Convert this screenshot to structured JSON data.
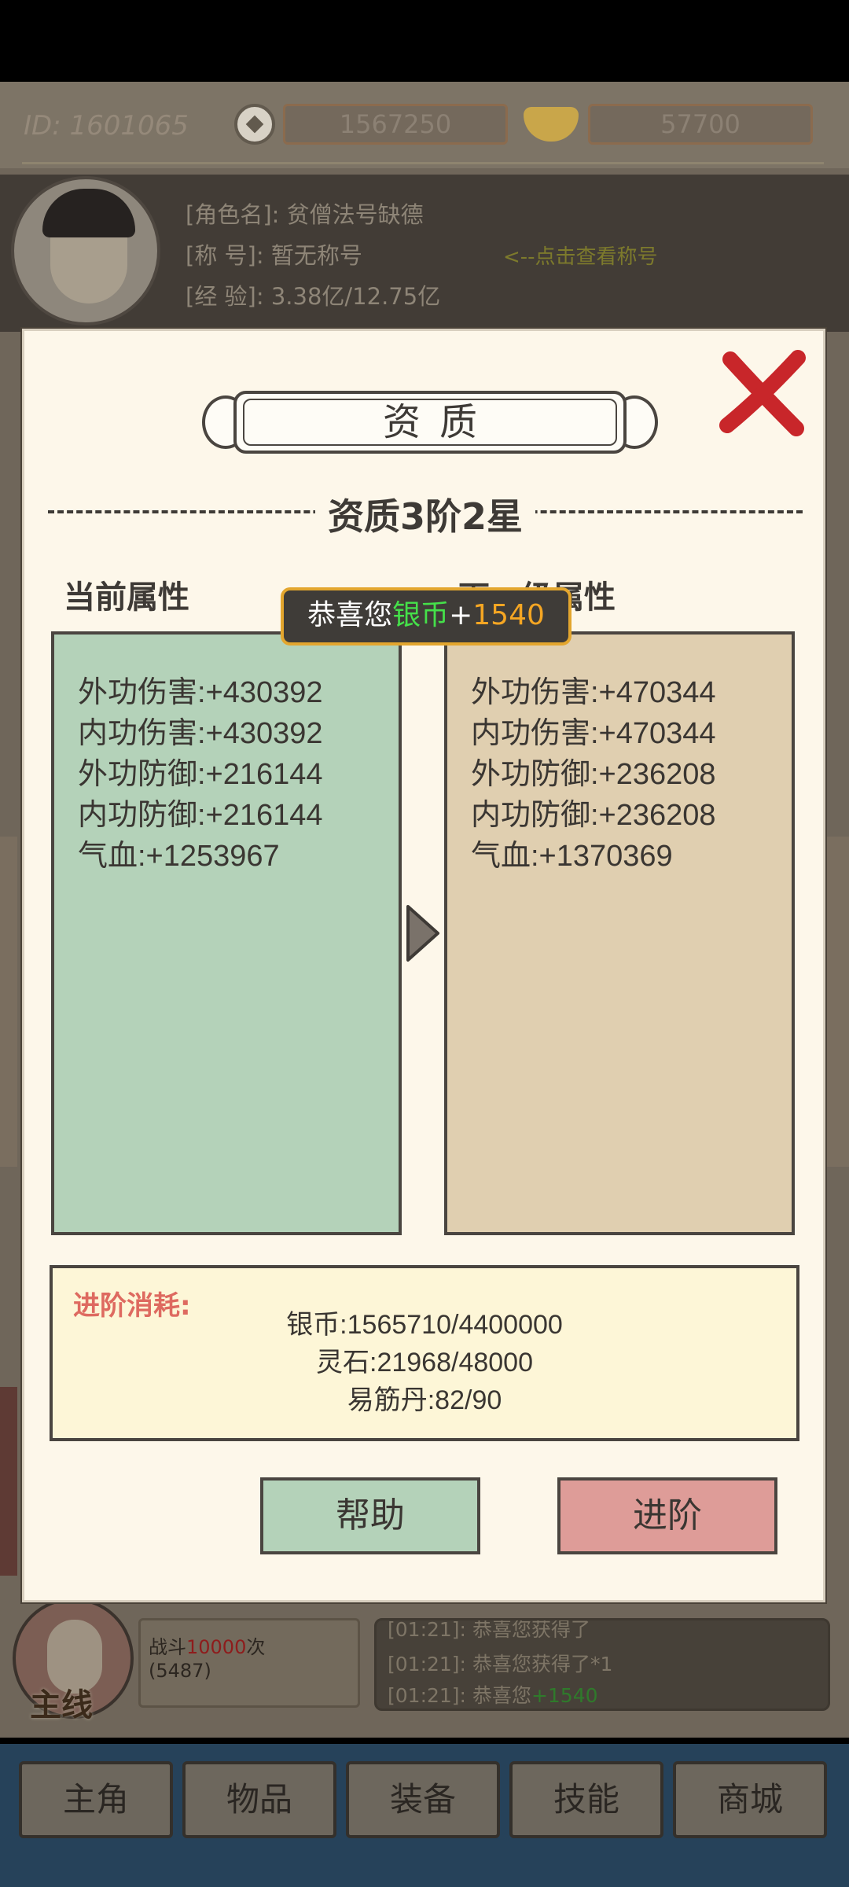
{
  "hud": {
    "player_id": "ID: 1601065",
    "silver": "1567250",
    "gold": "57700"
  },
  "profile": {
    "name_line": "[角色名]: 贫僧法号缺德",
    "title_line": "[称  号]: 暂无称号",
    "exp_line": "[经  验]: 3.38亿/12.75亿",
    "title_hint": "<--点击查看称号"
  },
  "dialog": {
    "title": "资质",
    "stage": "资质3阶2星",
    "current_header": "当前属性",
    "next_header": "下一级属性",
    "current_stats": [
      "外功伤害:+430392",
      "内功伤害:+430392",
      "外功防御:+216144",
      "内功防御:+216144",
      "气血:+1253967"
    ],
    "next_stats": [
      "外功伤害:+470344",
      "内功伤害:+470344",
      "外功防御:+236208",
      "内功防御:+236208",
      "气血:+1370369"
    ],
    "cost_label": "进阶消耗:",
    "costs": [
      "银币:1565710/4400000",
      "灵石:21968/48000",
      "易筋丹:82/90"
    ],
    "help_button": "帮助",
    "advance_button": "进阶"
  },
  "toast": {
    "prefix": "恭喜您",
    "item": "银币",
    "plus": "+",
    "amount": "1540"
  },
  "bottom": {
    "main_quest_label": "主线",
    "battle_prefix": "战斗",
    "battle_count": "10000",
    "battle_suffix": "次",
    "battle_sub": "(5487)",
    "log": [
      {
        "time": "[01:21]:",
        "text": "恭喜您获得了",
        "item": "",
        "extra": ""
      },
      {
        "time": "[01:21]:",
        "text": "恭喜您获得了",
        "item": "",
        "extra": "*1"
      },
      {
        "time": "[01:21]:",
        "text": "恭喜您",
        "item": "",
        "extra": "+1540"
      }
    ]
  },
  "nav": [
    "主角",
    "物品",
    "装备",
    "技能",
    "商城"
  ],
  "colors": {
    "current_panel": "#b4d2b9",
    "next_panel": "#e0cfb0",
    "close_x": "#c8262a",
    "toast_border": "#e3a62e",
    "toast_green": "#45e04a",
    "toast_orange": "#f5a623",
    "cost_label": "#de6a60",
    "advance_button": "#de9c98"
  },
  "icons": [
    "silver-coin-icon",
    "gold-ingot-icon",
    "close-icon",
    "arrow-right-icon"
  ]
}
